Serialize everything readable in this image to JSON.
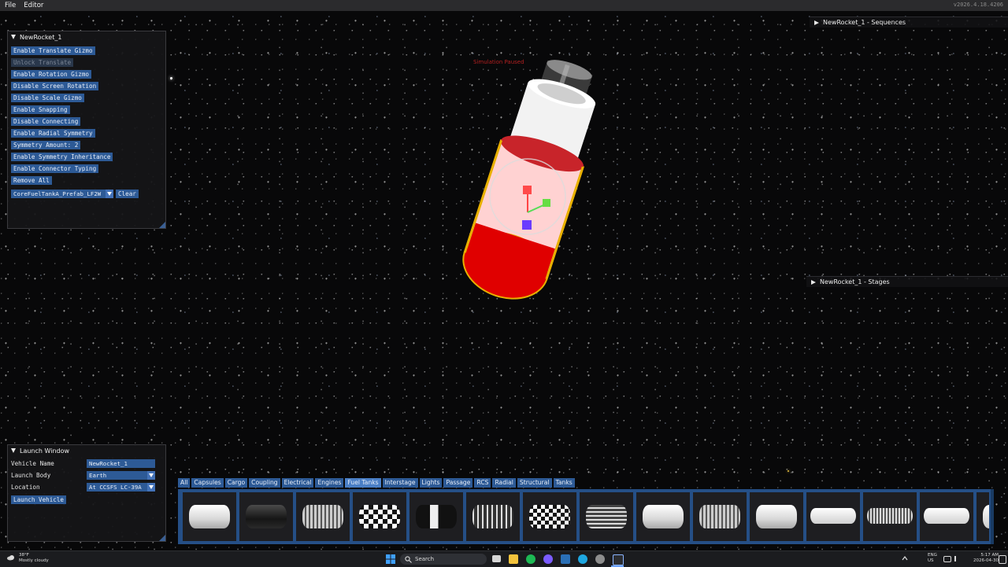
{
  "menubar": {
    "items": [
      "File",
      "Editor"
    ],
    "version": "v2026.4.18.4206"
  },
  "viewport": {
    "sim_status": "Simulation Paused"
  },
  "editor_window": {
    "title": "NewRocket_1",
    "buttons": [
      {
        "label": "Enable Translate Gizmo",
        "enabled": true
      },
      {
        "label": "Unlock Translate",
        "enabled": false
      },
      {
        "label": "Enable Rotation Gizmo",
        "enabled": true
      },
      {
        "label": "Disable Screen Rotation",
        "enabled": true
      },
      {
        "label": "Disable Scale Gizmo",
        "enabled": true
      },
      {
        "label": "Enable Snapping",
        "enabled": true
      },
      {
        "label": "Disable Connecting",
        "enabled": true
      },
      {
        "label": "Enable Radial Symmetry",
        "enabled": true
      },
      {
        "label": "Symmetry Amount: 2",
        "enabled": true
      },
      {
        "label": "Enable Symmetry Inheritance",
        "enabled": true
      },
      {
        "label": "Enable Connector Typing",
        "enabled": true
      },
      {
        "label": "Remove All",
        "enabled": true
      }
    ],
    "selected_part": "CoreFuelTankA_Prefab_LF2W",
    "clear_label": "Clear"
  },
  "sequences": {
    "title": "NewRocket_1 - Sequences"
  },
  "stages": {
    "title": "NewRocket_1 - Stages"
  },
  "launch_window": {
    "title": "Launch Window",
    "vehicle_name_label": "Vehicle Name",
    "vehicle_name_value": "NewRocket_1",
    "launch_body_label": "Launch Body",
    "launch_body_value": "Earth",
    "location_label": "Location",
    "location_value": "At CCSFS LC-39A",
    "launch_button": "Launch Vehicle"
  },
  "parts_bar": {
    "categories": [
      "All",
      "Capsules",
      "Cargo",
      "Coupling",
      "Electrical",
      "Engines",
      "Fuel Tanks",
      "Interstage",
      "Lights",
      "Passage",
      "RCS",
      "Radial",
      "Structural",
      "Tanks"
    ],
    "active_category": "Fuel Tanks",
    "part_styles": [
      "white",
      "dark",
      "ribbed",
      "checker",
      "stripe",
      "cage",
      "checker2",
      "cage2",
      "white",
      "ribbed",
      "white",
      "slim",
      "ribbed-slim",
      "slim",
      "white-cut"
    ]
  },
  "taskbar": {
    "weather_temp": "38°F",
    "weather_desc": "Mostly cloudy",
    "search_label": "Search",
    "lang_top": "ENG",
    "lang_bottom": "US",
    "time": "5:17 AM",
    "date": "2026-04-30"
  }
}
